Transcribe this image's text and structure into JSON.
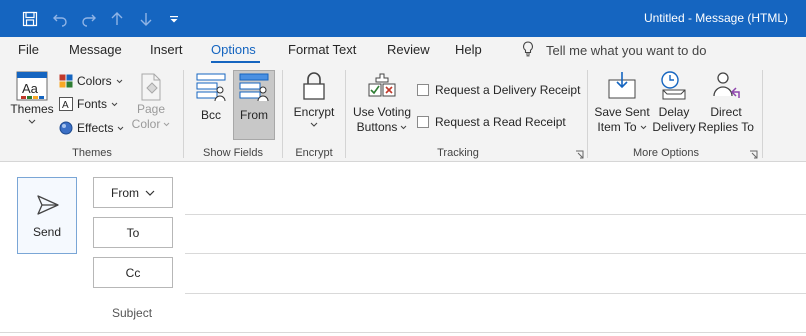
{
  "window": {
    "title": "Untitled  -  Message (HTML)"
  },
  "colors": {
    "accent": "#1565c0",
    "titlebar": "#1565c0",
    "ribbon_bg": "#f3f3f3"
  },
  "qat": {
    "icons": [
      "save-icon",
      "undo-icon",
      "redo-icon",
      "up-arrow-icon",
      "down-arrow-icon",
      "customize-qat-icon"
    ]
  },
  "tabs": [
    {
      "label": "File"
    },
    {
      "label": "Message"
    },
    {
      "label": "Insert"
    },
    {
      "label": "Options"
    },
    {
      "label": "Format Text"
    },
    {
      "label": "Review"
    },
    {
      "label": "Help"
    }
  ],
  "active_tab": "Options",
  "tell_me": {
    "text": "Tell me what you want to do",
    "icon": "lightbulb-icon"
  },
  "ribbon": {
    "themes_group": {
      "label": "Themes",
      "themes_button": "Themes",
      "colors_button": "Colors",
      "fonts_button": "Fonts",
      "effects_button": "Effects",
      "page_color_button": [
        "Page",
        "Color"
      ]
    },
    "show_fields_group": {
      "label": "Show Fields",
      "bcc_button": "Bcc",
      "from_button": "From"
    },
    "encrypt_group": {
      "label": "Encrypt",
      "encrypt_button": "Encrypt"
    },
    "tracking_group": {
      "label": "Tracking",
      "voting_button": [
        "Use Voting",
        "Buttons"
      ],
      "delivery_receipt": "Request a Delivery Receipt",
      "read_receipt": "Request a Read Receipt"
    },
    "more_options_group": {
      "label": "More Options",
      "save_sent_button": [
        "Save Sent",
        "Item To"
      ],
      "delay_delivery_button": [
        "Delay",
        "Delivery"
      ],
      "direct_replies_button": [
        "Direct",
        "Replies To"
      ]
    }
  },
  "compose": {
    "send_label": "Send",
    "from_label": "From",
    "to_label": "To",
    "cc_label": "Cc",
    "subject_label": "Subject"
  }
}
